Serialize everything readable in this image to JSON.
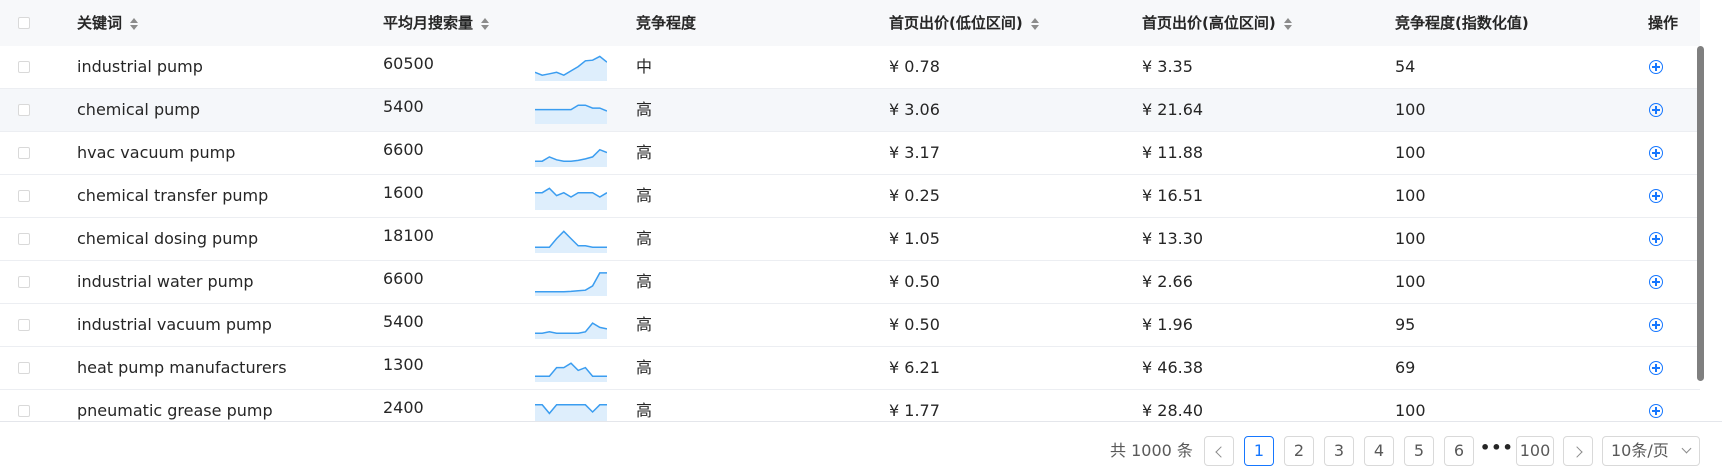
{
  "header": {
    "select_all": false,
    "col_keyword": "关键词",
    "col_avg_monthly": "平均月搜索量",
    "col_competition": "竞争程度",
    "col_bid_low": "首页出价(低位区间)",
    "col_bid_high": "首页出价(高位区间)",
    "col_competition_index": "竞争程度(指数化值)",
    "col_action": "操作"
  },
  "rows": [
    {
      "keyword": "industrial pump",
      "volume": "60500",
      "trend": [
        3,
        2,
        2.5,
        3,
        2,
        3.5,
        5,
        7,
        7.2,
        8.5,
        6.5
      ],
      "competition": "中",
      "bid_low": "¥ 0.78",
      "bid_high": "¥ 3.35",
      "index": "54",
      "highlighted": false
    },
    {
      "keyword": "chemical pump",
      "volume": "5400",
      "trend": [
        5,
        5,
        5,
        5,
        5,
        5,
        6.5,
        6.5,
        5.5,
        5.5,
        4.5
      ],
      "competition": "高",
      "bid_low": "¥ 3.06",
      "bid_high": "¥ 21.64",
      "index": "100",
      "highlighted": true
    },
    {
      "keyword": "hvac vacuum pump",
      "volume": "6600",
      "trend": [
        2,
        2,
        3.5,
        2.5,
        2,
        2,
        2.3,
        2.8,
        3.5,
        6,
        5
      ],
      "competition": "高",
      "bid_low": "¥ 3.17",
      "bid_high": "¥ 11.88",
      "index": "100",
      "highlighted": false
    },
    {
      "keyword": "chemical transfer pump",
      "volume": "1600",
      "trend": [
        6,
        6,
        7.5,
        5,
        6,
        4.5,
        6,
        6,
        6,
        4.5,
        6
      ],
      "competition": "高",
      "bid_low": "¥ 0.25",
      "bid_high": "¥ 16.51",
      "index": "100",
      "highlighted": false
    },
    {
      "keyword": "chemical dosing pump",
      "volume": "18100",
      "trend": [
        2,
        2,
        2,
        5,
        7.5,
        5,
        2.5,
        2.5,
        2,
        2,
        2
      ],
      "competition": "高",
      "bid_low": "¥ 1.05",
      "bid_high": "¥ 13.30",
      "index": "100",
      "highlighted": false
    },
    {
      "keyword": "industrial water pump",
      "volume": "6600",
      "trend": [
        1.5,
        1.5,
        1.5,
        1.5,
        1.5,
        1.6,
        1.8,
        2,
        3.5,
        8,
        8
      ],
      "competition": "高",
      "bid_low": "¥ 0.50",
      "bid_high": "¥ 2.66",
      "index": "100",
      "highlighted": false
    },
    {
      "keyword": "industrial vacuum pump",
      "volume": "5400",
      "trend": [
        2,
        2,
        2.5,
        2,
        2,
        2,
        2,
        2.5,
        5.5,
        4,
        3.5
      ],
      "competition": "高",
      "bid_low": "¥ 0.50",
      "bid_high": "¥ 1.96",
      "index": "95",
      "highlighted": false
    },
    {
      "keyword": "heat pump manufacturers",
      "volume": "1300",
      "trend": [
        2,
        2,
        2,
        5,
        5,
        6.5,
        4,
        5,
        2,
        2,
        2
      ],
      "competition": "高",
      "bid_low": "¥ 6.21",
      "bid_high": "¥ 46.38",
      "index": "69",
      "highlighted": false
    },
    {
      "keyword": "pneumatic grease pump",
      "volume": "2400",
      "trend": [
        7,
        7,
        4,
        7,
        7,
        7,
        7,
        7,
        4.5,
        7,
        7
      ],
      "competition": "高",
      "bid_low": "¥ 1.77",
      "bid_high": "¥ 28.40",
      "index": "100",
      "highlighted": false
    }
  ],
  "pagination": {
    "total_text": "共 1000 条",
    "pages": [
      "1",
      "2",
      "3",
      "4",
      "5",
      "6"
    ],
    "current": "1",
    "ellipsis": "•••",
    "last_page": "100",
    "page_size": "10条/页"
  },
  "colors": {
    "accent": "#1677ff",
    "spark_line": "#3b9df0",
    "spark_fill": "#deeefc",
    "header_bg": "#f7f8fa",
    "row_highlight": "#f5f7fa"
  }
}
